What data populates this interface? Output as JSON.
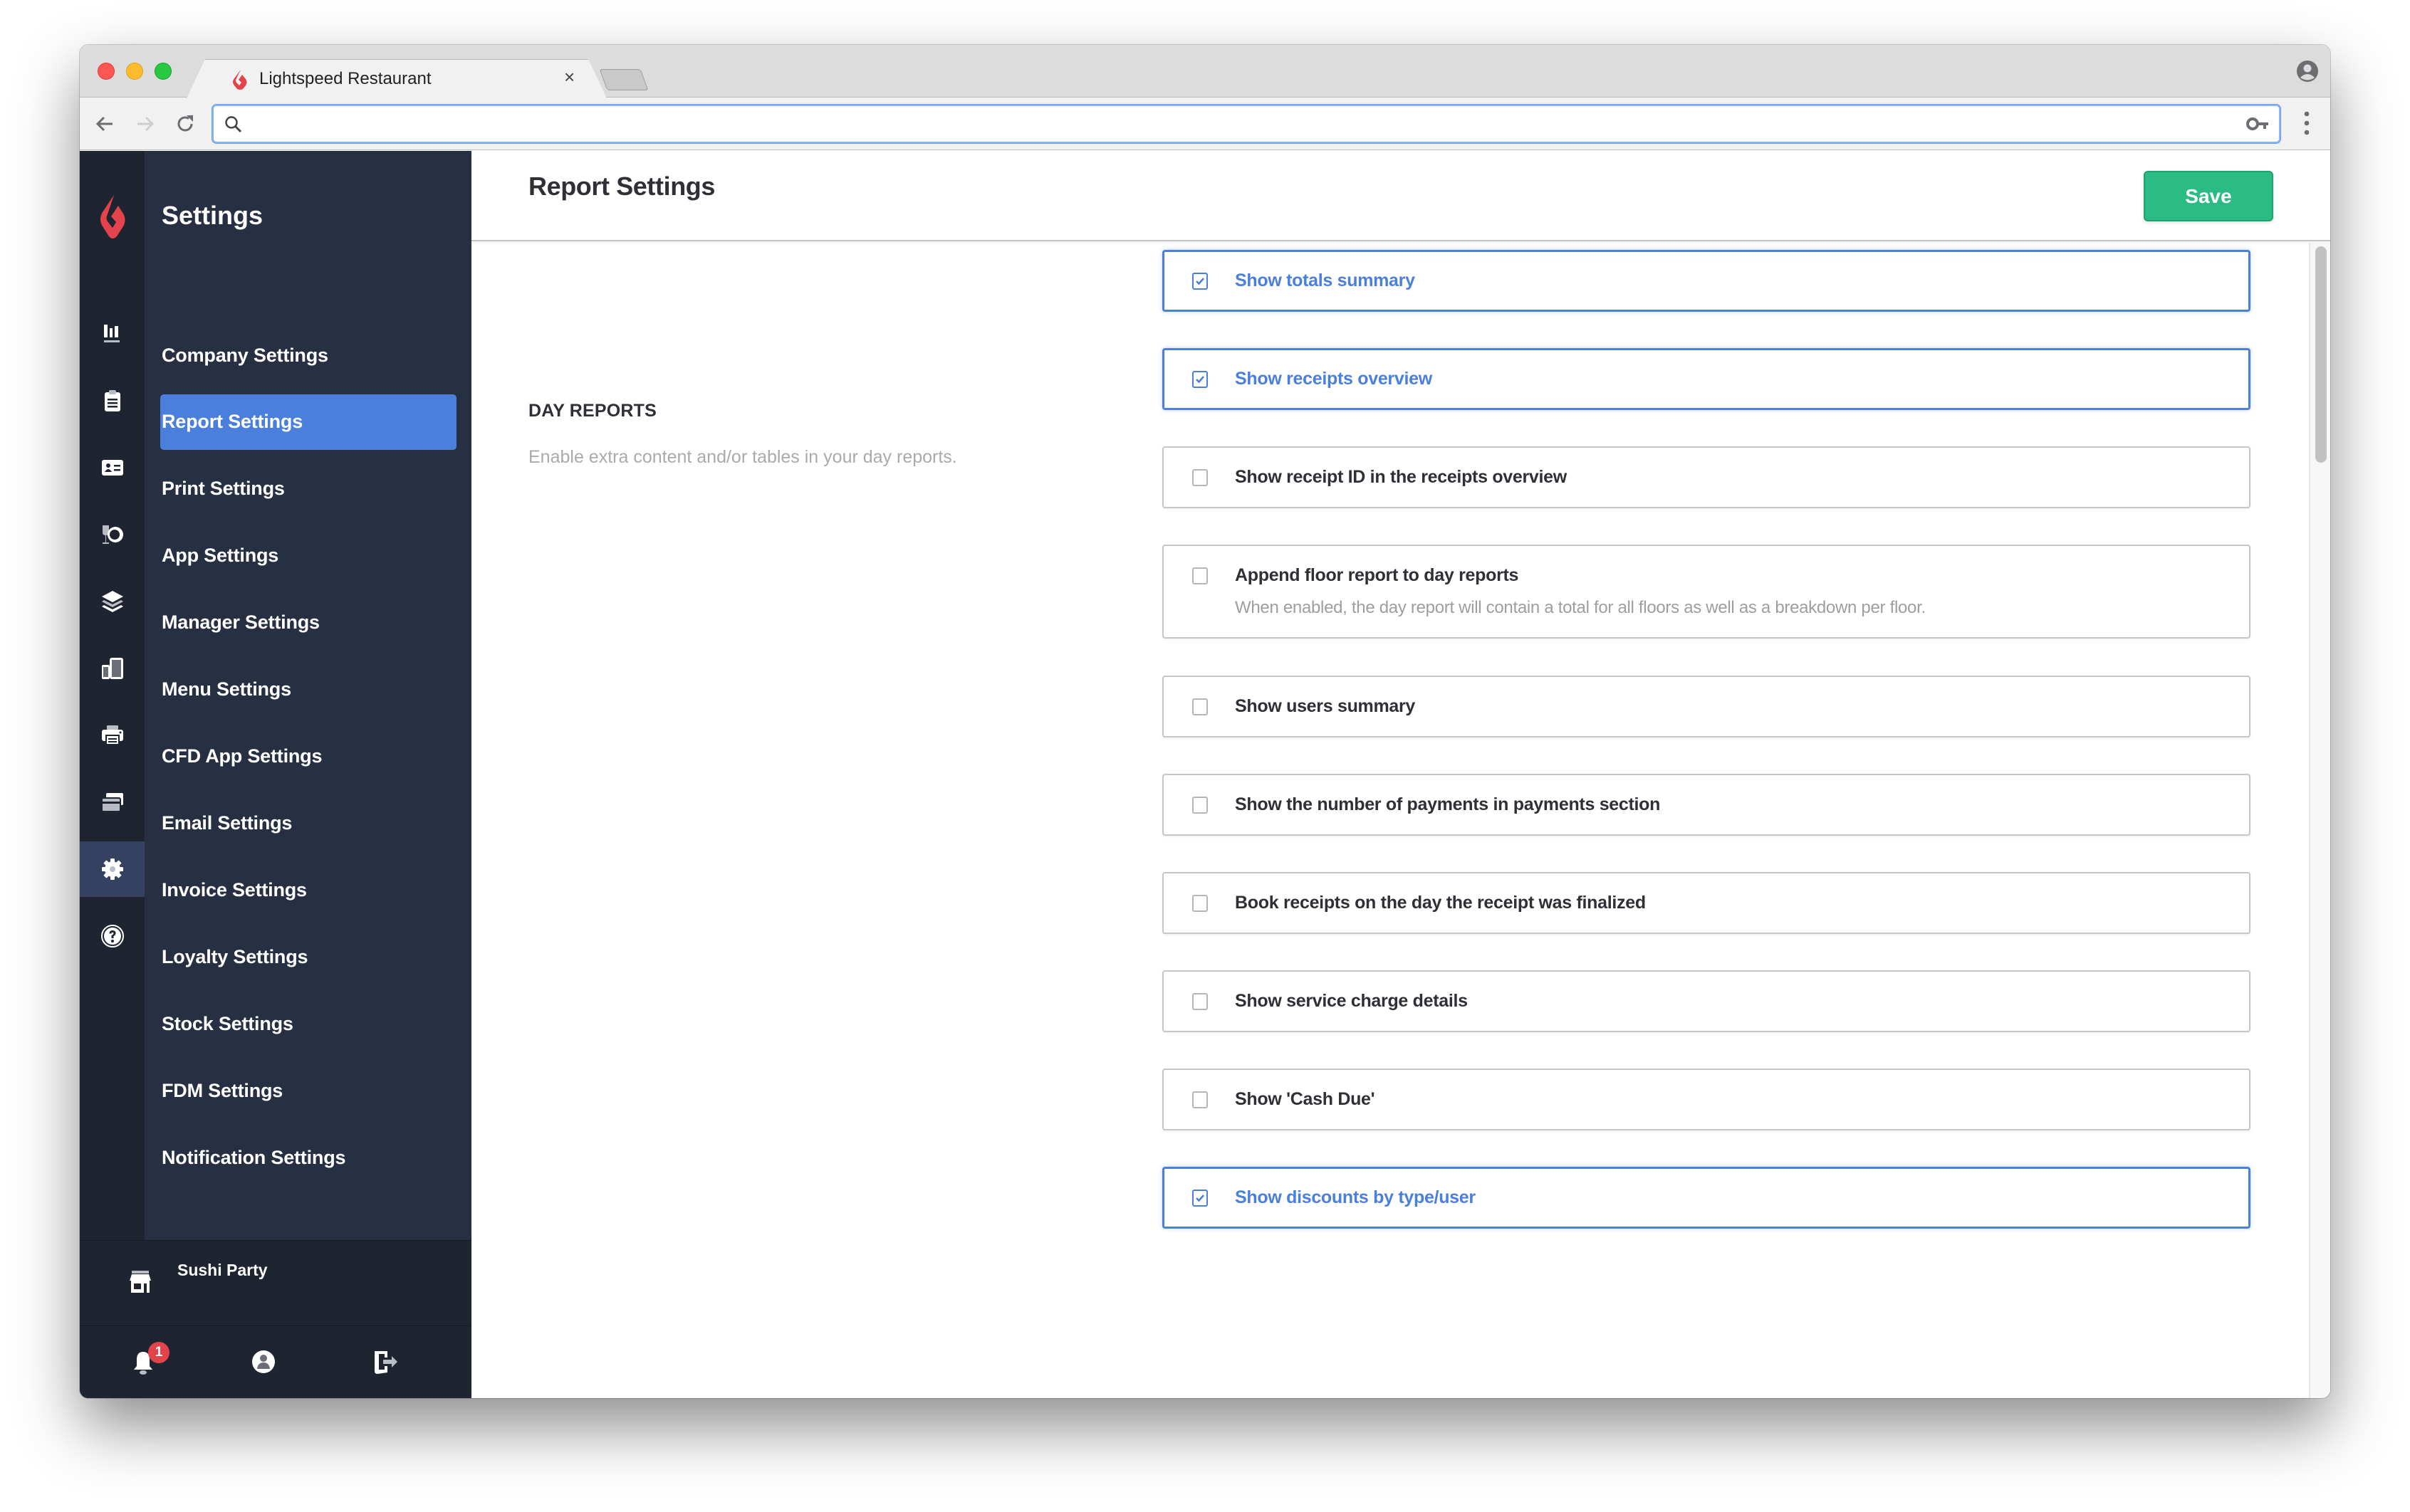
{
  "browser": {
    "tab_title": "Lightspeed Restaurant",
    "tab_close": "×",
    "address_value": "",
    "address_placeholder": ""
  },
  "sidebar": {
    "title": "Settings",
    "rail_icons": [
      {
        "name": "reports-chart-icon"
      },
      {
        "name": "clipboard-icon"
      },
      {
        "name": "id-card-icon"
      },
      {
        "name": "glass-plate-icon"
      },
      {
        "name": "layers-icon"
      },
      {
        "name": "devices-icon"
      },
      {
        "name": "printer-icon"
      },
      {
        "name": "cards-icon"
      },
      {
        "name": "gear-icon",
        "active": true
      },
      {
        "name": "help-icon"
      }
    ],
    "items": [
      {
        "label": "Company Settings"
      },
      {
        "label": "Report Settings",
        "active": true
      },
      {
        "label": "Print Settings"
      },
      {
        "label": "App Settings"
      },
      {
        "label": "Manager Settings"
      },
      {
        "label": "Menu Settings"
      },
      {
        "label": "CFD App Settings"
      },
      {
        "label": "Email Settings"
      },
      {
        "label": "Invoice Settings"
      },
      {
        "label": "Loyalty Settings"
      },
      {
        "label": "Stock Settings"
      },
      {
        "label": "FDM Settings"
      },
      {
        "label": "Notification Settings"
      }
    ],
    "store_name": "Sushi Party",
    "notification_count": "1"
  },
  "main": {
    "page_title": "Report Settings",
    "save_label": "Save",
    "section": {
      "title": "DAY REPORTS",
      "description": "Enable extra content and/or tables in your day reports."
    },
    "options": [
      {
        "label": "Show totals summary",
        "checked": true
      },
      {
        "label": "Show receipts overview",
        "checked": true
      },
      {
        "label": "Show receipt ID in the receipts overview",
        "checked": false
      },
      {
        "label": "Append floor report to day reports",
        "checked": false,
        "description": "When enabled, the day report will contain a total for all floors as well as a breakdown per floor."
      },
      {
        "label": "Show users summary",
        "checked": false
      },
      {
        "label": "Show the number of payments in payments section",
        "checked": false
      },
      {
        "label": "Book receipts on the day the receipt was finalized",
        "checked": false
      },
      {
        "label": "Show service charge details",
        "checked": false
      },
      {
        "label": "Show 'Cash Due'",
        "checked": false
      },
      {
        "label": "Show discounts by type/user",
        "checked": true
      }
    ]
  },
  "colors": {
    "accent": "#4a7fdd",
    "save": "#2bbb84",
    "sidebar_dark": "#1f2431",
    "sidebar": "#272f42",
    "brand_red": "#e3434b"
  }
}
